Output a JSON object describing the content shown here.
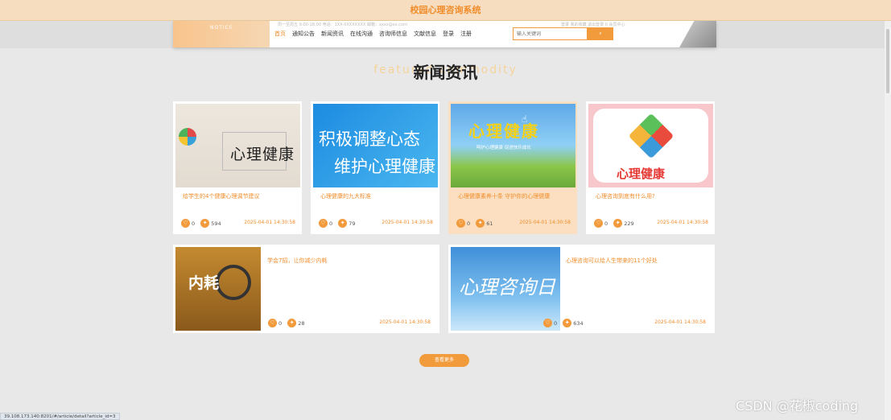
{
  "app_title": "校园心理咨询系统",
  "header": {
    "logo_text": "NOTICE",
    "top_info": "周一至周五 9:00-18:00   电话：1XX-XXXXXXXX   邮箱：xxxx@xx.com",
    "top_right": "登录  我的收藏  退出登录 0  会员中心",
    "nav": [
      "首页",
      "通知公告",
      "新闻资讯",
      "在线沟通",
      "咨询师信息",
      "文献信息",
      "登录",
      "注册"
    ],
    "search_placeholder": "输入关键词",
    "search_button": "搜索"
  },
  "section": {
    "title": "新闻资讯",
    "bg_text": "featured commodity"
  },
  "articles_row1": [
    {
      "image_caption": "心理健康",
      "title": "给学生的4个健康心理调节建议",
      "likes": "0",
      "views": "594",
      "date": "2025-04-01 14:30:58"
    },
    {
      "image_caption_1": "积极调整心态",
      "image_caption_2": "维护心理健康",
      "title": "心理健康的九大标准",
      "likes": "0",
      "views": "79",
      "date": "2025-04-01 14:30:58"
    },
    {
      "image_caption": "心理健康",
      "image_sub": "呵护心理健康 促进快乐成长",
      "title": "心理健康素养十条 守护你的心理健康",
      "likes": "0",
      "views": "61",
      "date": "2025-04-01 14:30:58"
    },
    {
      "image_caption": "心理健康",
      "title": "心理咨询到底有什么用?",
      "likes": "0",
      "views": "229",
      "date": "2025-04-01 14:30:58"
    }
  ],
  "articles_row2": [
    {
      "image_caption": "内耗",
      "title": "学会7招，让你减少内耗",
      "likes": "0",
      "views": "28",
      "date": "2025-04-01 14:30:58"
    },
    {
      "image_caption": "心理咨询日",
      "title": "心理咨询可以给人生带来的11个好处",
      "likes": "0",
      "views": "634",
      "date": "2025-04-01 14:30:58"
    }
  ],
  "more_button": "查看更多",
  "status_url": "39.108.173.140:8201/#/article/detail?article_id=3",
  "watermark": "CSDN @花椒coding",
  "colors": {
    "accent": "#f29b3c",
    "title_bar": "#f6ddbf",
    "text_accent": "#f08c2a"
  }
}
